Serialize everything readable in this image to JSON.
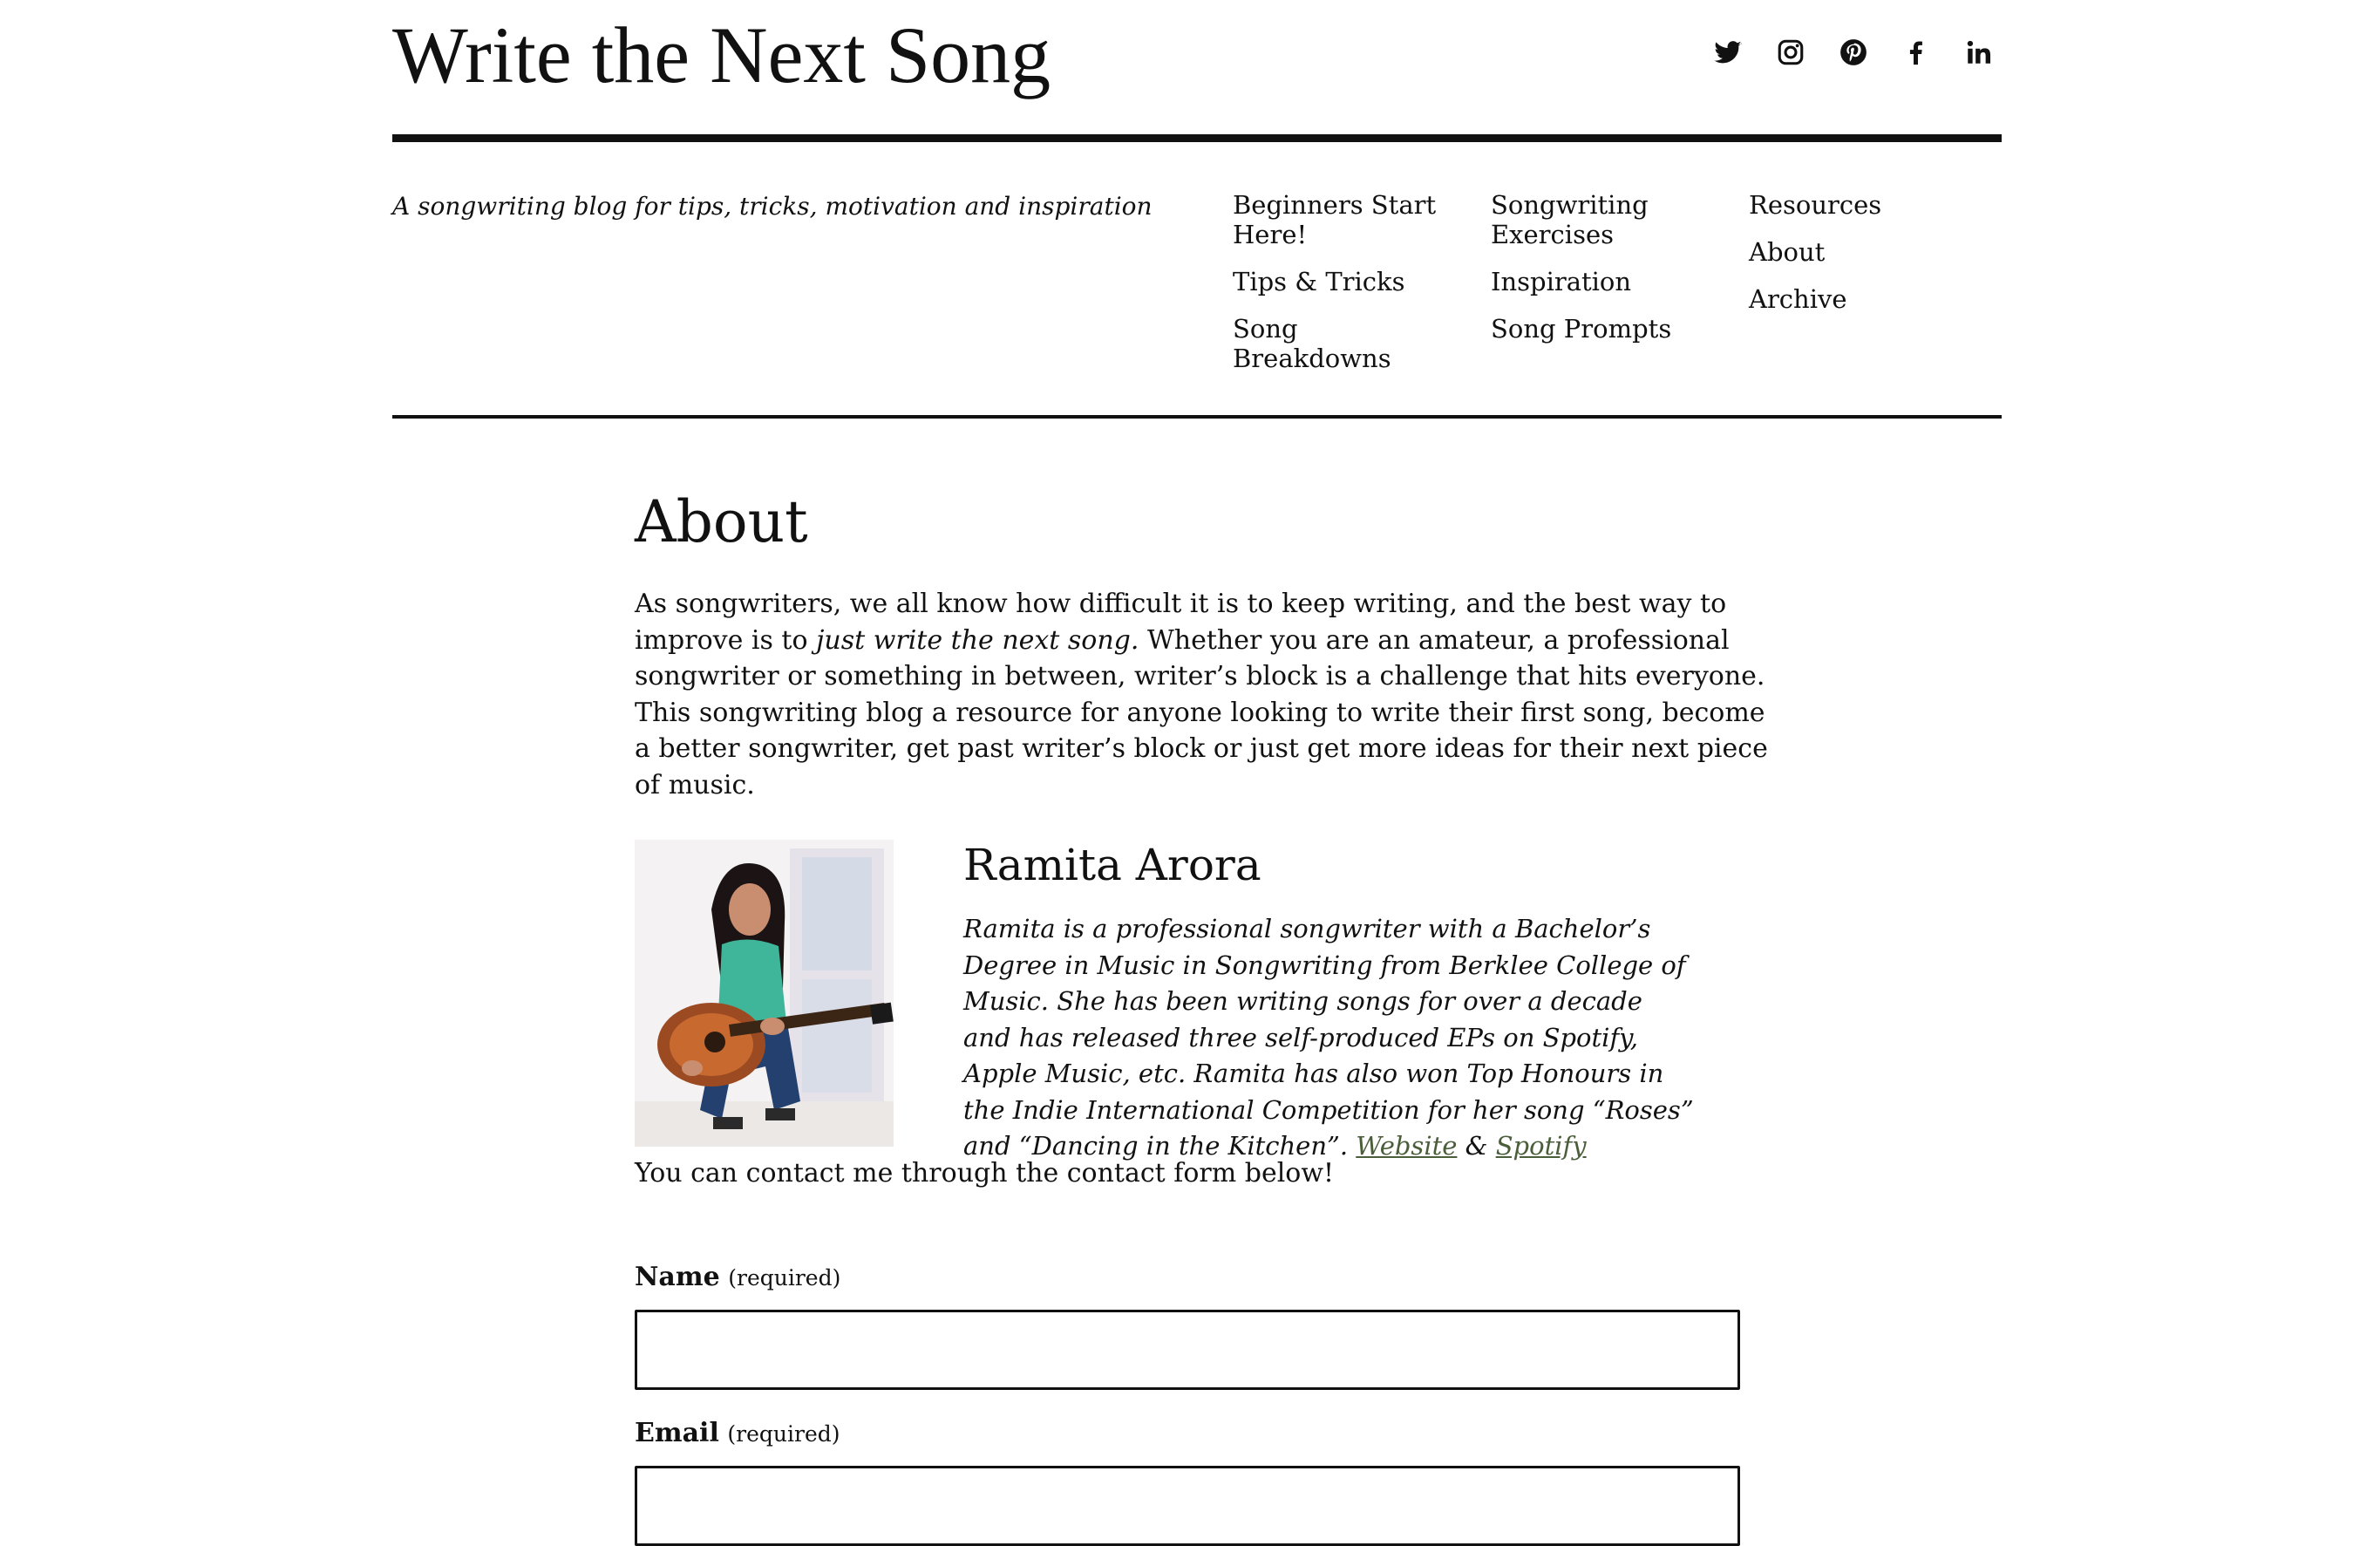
{
  "site": {
    "title": "Write the Next Song",
    "tagline": "A songwriting blog for tips, tricks, motivation and inspiration"
  },
  "social": [
    {
      "name": "twitter-icon"
    },
    {
      "name": "instagram-icon"
    },
    {
      "name": "pinterest-icon"
    },
    {
      "name": "facebook-icon"
    },
    {
      "name": "linkedin-icon"
    }
  ],
  "nav": {
    "columns": [
      [
        "Beginners Start Here!",
        "Tips & Tricks",
        "Song Breakdowns"
      ],
      [
        "Songwriting Exercises",
        "Inspiration",
        "Song Prompts"
      ],
      [
        "Resources",
        "About",
        "Archive"
      ]
    ]
  },
  "page": {
    "title": "About",
    "intro_before": "As songwriters, we all know how difficult it is to keep writing, and the best way to improve is to ",
    "intro_em": "just write the next song.",
    "intro_after": " Whether you are an amateur, a professional songwriter or something in between, writer’s block is a challenge that hits everyone. This songwriting blog a resource for anyone looking to write their first song, become a better songwriter, get past writer’s block or just get more ideas for their next piece of music."
  },
  "author": {
    "name": "Ramita Arora",
    "bio": "Ramita is a professional songwriter with a Bachelor’s Degree in Music in Songwriting from Berklee College of Music. She has been writing songs for over a decade and has released three self-produced EPs on Spotify, Apple Music, etc. Ramita has also won Top Honours in the Indie International Competition for her song “Roses” and “Dancing in the Kitchen”. ",
    "website_label": "Website",
    "separator": " & ",
    "spotify_label": "Spotify"
  },
  "contact": {
    "text": "You can contact me through the contact form below!"
  },
  "form": {
    "name_label": "Name",
    "name_required": "(required)",
    "email_label": "Email",
    "email_required": "(required)"
  },
  "colors": {
    "text": "#111111",
    "link": "#4a5e3a",
    "background": "#ffffff"
  }
}
